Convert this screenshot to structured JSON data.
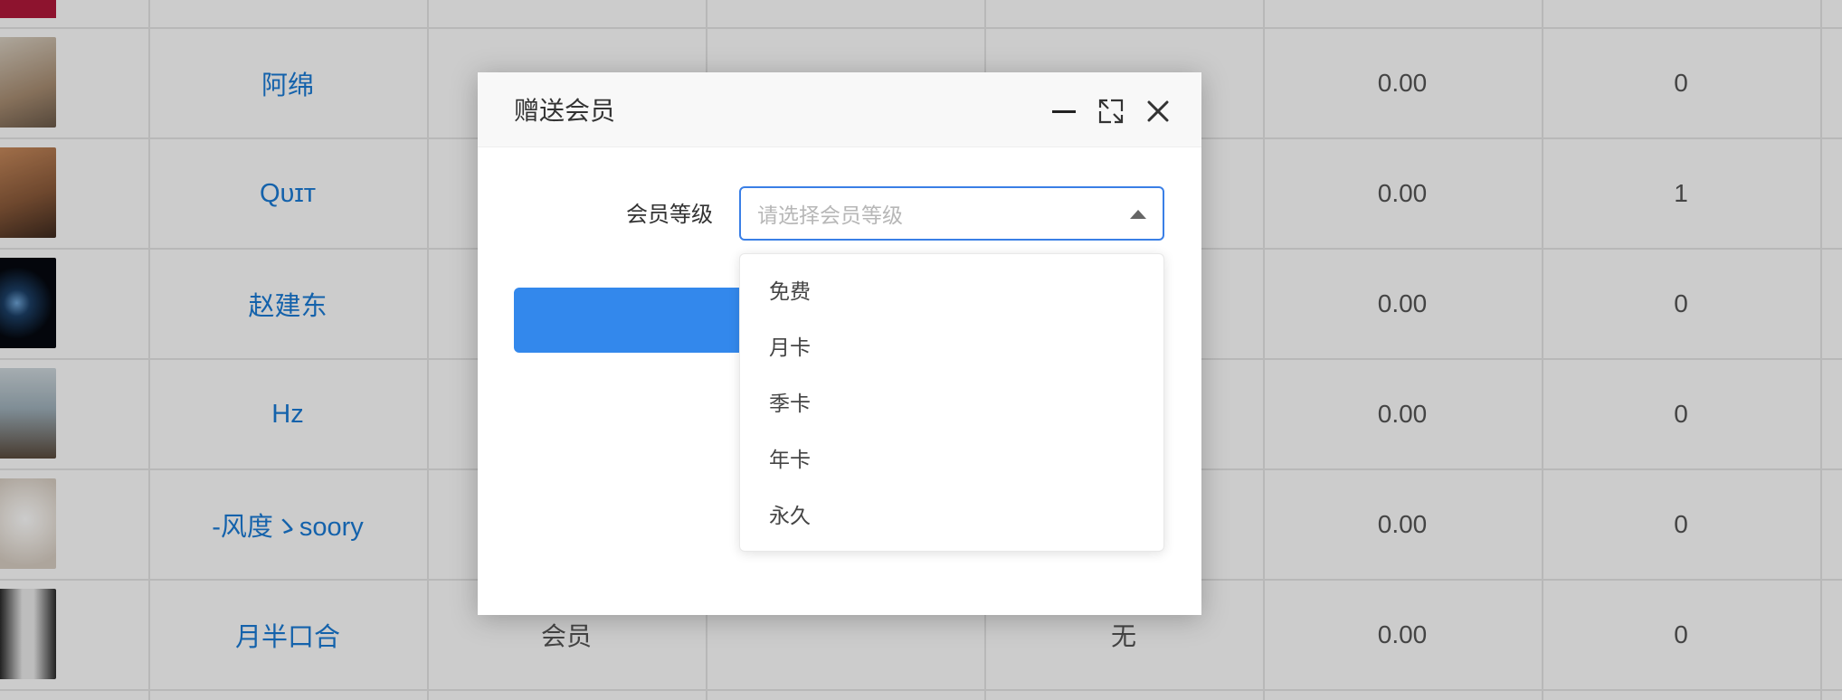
{
  "table": {
    "rows": [
      {
        "name": "阿绵",
        "col3": "",
        "col5": "",
        "balance": "0.00",
        "count": "0"
      },
      {
        "name": "Qᴜɪᴛ",
        "col3": "",
        "col5": "",
        "balance": "0.00",
        "count": "1"
      },
      {
        "name": "赵建东",
        "col3": "",
        "col5": "",
        "balance": "0.00",
        "count": "0"
      },
      {
        "name": "Hz",
        "col3": "",
        "col5": "",
        "balance": "0.00",
        "count": "0"
      },
      {
        "name": "-风度ゝsoory",
        "col3": "",
        "col5": "",
        "balance": "0.00",
        "count": "0"
      },
      {
        "name": "月半口合",
        "col3": "会员",
        "col5": "无",
        "balance": "0.00",
        "count": "0"
      }
    ]
  },
  "dialog": {
    "title": "赠送会员",
    "field_label": "会员等级",
    "select_placeholder": "请选择会员等级",
    "options": [
      "免费",
      "月卡",
      "季卡",
      "年卡",
      "永久"
    ]
  },
  "colors": {
    "link": "#1a7bd6",
    "primary": "#3388ec",
    "focus_border": "#3a7fe6"
  }
}
